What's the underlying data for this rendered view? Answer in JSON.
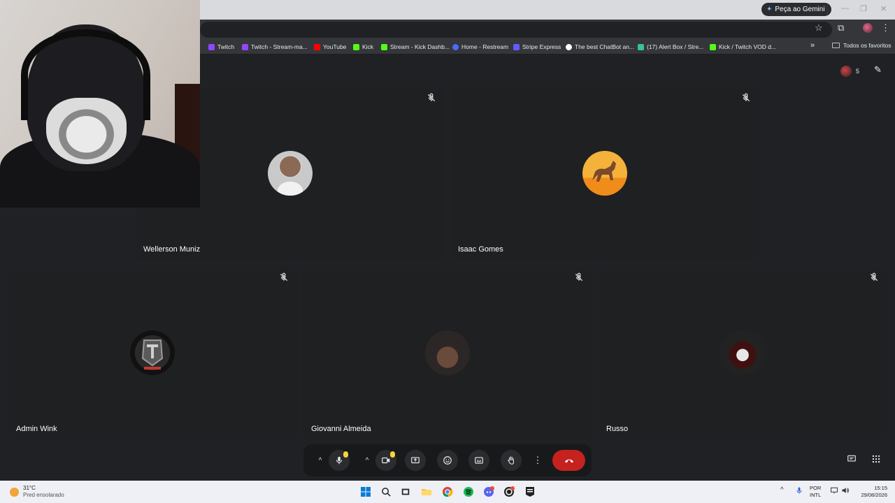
{
  "browser": {
    "gemini_label": "Peça ao Gemini",
    "bookmarks": [
      {
        "label": "Twitch",
        "color": "#9146ff"
      },
      {
        "label": "Twitch - Stream-ma...",
        "color": "#9146ff"
      },
      {
        "label": "YouTube",
        "color": "#ff0000"
      },
      {
        "label": "Kick",
        "color": "#53fc18"
      },
      {
        "label": "Stream - Kick Dashb...",
        "color": "#53fc18"
      },
      {
        "label": "Home - Restream",
        "color": "#4a6cf7"
      },
      {
        "label": "Stripe Express",
        "color": "#635bff"
      },
      {
        "label": "The best ChatBot an...",
        "color": "#ffffff"
      },
      {
        "label": "(17) Alert Box / Stre...",
        "color": "#31c3a2"
      },
      {
        "label": "Kick / Twitch VOD d...",
        "color": "#53fc18"
      }
    ],
    "more_label": "»",
    "folder_label": "Todos os favoritos"
  },
  "meet": {
    "participant_count": "5",
    "participants": [
      {
        "name": "Wellerson Muniz",
        "muted": true
      },
      {
        "name": "Isaac Gomes",
        "muted": true
      },
      {
        "name": "Admin Wink",
        "muted": true
      },
      {
        "name": "Giovanni Almeida",
        "muted": true
      },
      {
        "name": "Russo",
        "muted": true
      }
    ],
    "controls": {
      "arrow": "^",
      "hangup_icon": "phone-hangup-icon"
    }
  },
  "taskbar": {
    "temperature": "31°C",
    "weather": "Pred ensolarado",
    "lang_line1": "POR",
    "lang_line2": "INTL",
    "time": "15:15",
    "date": "29/08/2026"
  }
}
